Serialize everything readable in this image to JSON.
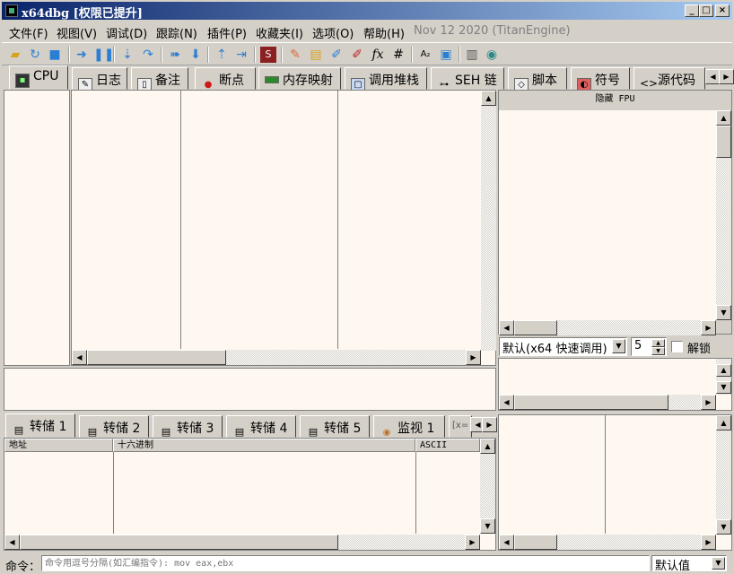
{
  "window": {
    "title": "x64dbg [权限已提升]",
    "min": "_",
    "max": "□",
    "close": "×"
  },
  "menus": [
    "文件(F)",
    "视图(V)",
    "调试(D)",
    "跟踪(N)",
    "插件(P)",
    "收藏夹(I)",
    "选项(O)",
    "帮助(H)"
  ],
  "version_text": "Nov 12 2020 (TitanEngine)",
  "toolbar_icons": [
    "open-icon",
    "restart-icon",
    "stop-icon",
    "run-icon",
    "pause-icon",
    "step-into-icon",
    "step-over-icon",
    "trace-into-icon",
    "trace-over-icon",
    "execute-till-return-icon",
    "run-to-user-code-icon",
    "scylla-icon",
    "patch-icon",
    "comment-icon",
    "label-icon",
    "bookmark-icon",
    "function-icon",
    "hash-icon",
    "strings-icon",
    "calculator-icon",
    "notes-icon",
    "globe-icon"
  ],
  "tabs": [
    "CPU",
    "日志",
    "备注",
    "断点",
    "内存映射",
    "调用堆栈",
    "SEH 链",
    "脚本",
    "符号",
    "源代码"
  ],
  "fpu": {
    "header": "隐藏 FPU",
    "call_convention": "默认(x64 快速调用)",
    "arg_count": "5",
    "unlock_label": "解锁"
  },
  "dump_tabs": [
    "转储 1",
    "转储 2",
    "转储 3",
    "转储 4",
    "转储 5",
    "监视 1",
    "[x="
  ],
  "dump_headers": {
    "address": "地址",
    "hex": "十六进制",
    "ascii": "ASCII"
  },
  "command": {
    "label": "命令：",
    "placeholder": "命令用逗号分隔(如汇编指令): mov eax,ebx",
    "default_label": "默认值"
  }
}
